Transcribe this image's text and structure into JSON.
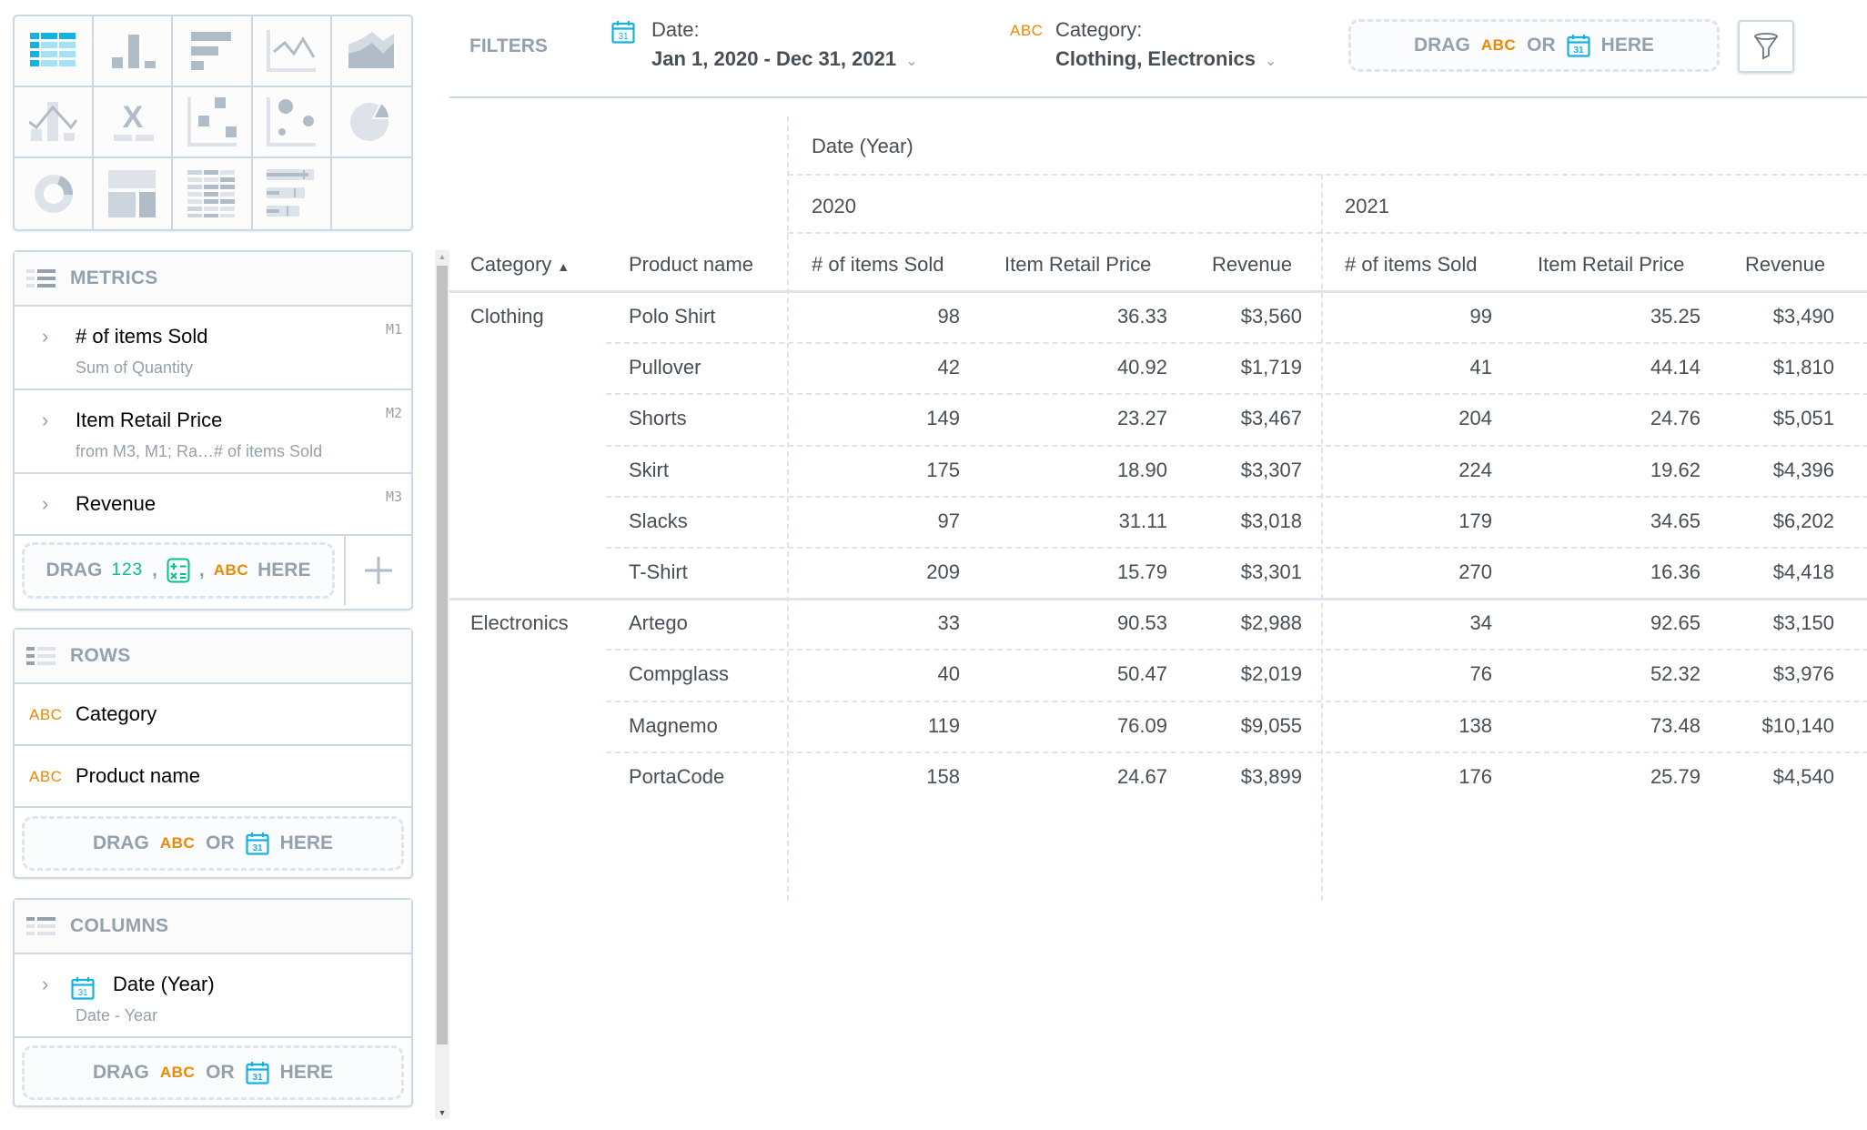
{
  "viz_types": [
    {
      "name": "table",
      "icon": "table-icon",
      "active": true
    },
    {
      "name": "column",
      "icon": "column-chart-icon"
    },
    {
      "name": "bar",
      "icon": "bar-chart-icon"
    },
    {
      "name": "line",
      "icon": "line-chart-icon"
    },
    {
      "name": "area",
      "icon": "area-chart-icon"
    },
    {
      "name": "combo",
      "icon": "combo-chart-icon"
    },
    {
      "name": "headline",
      "icon": "headline-icon"
    },
    {
      "name": "scatter",
      "icon": "scatter-plot-icon"
    },
    {
      "name": "bubble",
      "icon": "bubble-chart-icon"
    },
    {
      "name": "pie",
      "icon": "pie-chart-icon"
    },
    {
      "name": "donut",
      "icon": "donut-chart-icon"
    },
    {
      "name": "treemap",
      "icon": "treemap-icon"
    },
    {
      "name": "heatmap",
      "icon": "heatmap-icon"
    },
    {
      "name": "bullet",
      "icon": "bullet-chart-icon"
    }
  ],
  "metrics": {
    "title": "METRICS",
    "items": [
      {
        "name": "# of items Sold",
        "sub": "Sum of Quantity",
        "id": "M1"
      },
      {
        "name": "Item Retail Price",
        "sub": "from M3, M1; Ra…# of items Sold",
        "id": "M2"
      },
      {
        "name": "Revenue",
        "sub": "",
        "id": "M3"
      }
    ],
    "drop": {
      "drag": "DRAG",
      "num": "123",
      "comma": ",",
      "abc": "ABC",
      "here": "HERE"
    }
  },
  "rows": {
    "title": "ROWS",
    "items": [
      {
        "type": "ABC",
        "name": "Category"
      },
      {
        "type": "ABC",
        "name": "Product name"
      }
    ],
    "drop": {
      "drag": "DRAG",
      "abc": "ABC",
      "or": "OR",
      "here": "HERE"
    }
  },
  "columns": {
    "title": "COLUMNS",
    "items": [
      {
        "name": "Date (Year)",
        "sub": "Date - Year"
      }
    ],
    "drop": {
      "drag": "DRAG",
      "abc": "ABC",
      "or": "OR",
      "here": "HERE"
    }
  },
  "filters": {
    "label": "FILTERS",
    "date": {
      "label": "Date:",
      "value": "Jan 1, 2020 - Dec 31, 2021"
    },
    "category": {
      "type": "ABC",
      "label": "Category:",
      "value": "Clothing, Electronics"
    },
    "drop": {
      "drag": "DRAG",
      "abc": "ABC",
      "or": "OR",
      "here": "HERE"
    }
  },
  "calendar_day": "31",
  "colors": {
    "accent": "#14b2e2",
    "attribute": "#f18600",
    "measure": "#00c18d",
    "muted": "#94a1ad",
    "border": "#ccd8e2"
  },
  "table": {
    "column_attribute": "Date (Year)",
    "row_headers": [
      "Category",
      "Product name"
    ],
    "sort": "Category ascending",
    "years": [
      "2020",
      "2021"
    ],
    "measures": [
      "# of items Sold",
      "Item Retail Price",
      "Revenue"
    ],
    "rows": [
      {
        "category": "Clothing",
        "product": "Polo Shirt",
        "y2020": [
          "98",
          "36.33",
          "$3,560"
        ],
        "y2021": [
          "99",
          "35.25",
          "$3,490"
        ]
      },
      {
        "category": "",
        "product": "Pullover",
        "y2020": [
          "42",
          "40.92",
          "$1,719"
        ],
        "y2021": [
          "41",
          "44.14",
          "$1,810"
        ]
      },
      {
        "category": "",
        "product": "Shorts",
        "y2020": [
          "149",
          "23.27",
          "$3,467"
        ],
        "y2021": [
          "204",
          "24.76",
          "$5,051"
        ]
      },
      {
        "category": "",
        "product": "Skirt",
        "y2020": [
          "175",
          "18.90",
          "$3,307"
        ],
        "y2021": [
          "224",
          "19.62",
          "$4,396"
        ]
      },
      {
        "category": "",
        "product": "Slacks",
        "y2020": [
          "97",
          "31.11",
          "$3,018"
        ],
        "y2021": [
          "179",
          "34.65",
          "$6,202"
        ]
      },
      {
        "category": "",
        "product": "T-Shirt",
        "y2020": [
          "209",
          "15.79",
          "$3,301"
        ],
        "y2021": [
          "270",
          "16.36",
          "$4,418"
        ]
      },
      {
        "category": "Electronics",
        "product": "Artego",
        "y2020": [
          "33",
          "90.53",
          "$2,988"
        ],
        "y2021": [
          "34",
          "92.65",
          "$3,150"
        ]
      },
      {
        "category": "",
        "product": "Compglass",
        "y2020": [
          "40",
          "50.47",
          "$2,019"
        ],
        "y2021": [
          "76",
          "52.32",
          "$3,976"
        ]
      },
      {
        "category": "",
        "product": "Magnemo",
        "y2020": [
          "119",
          "76.09",
          "$9,055"
        ],
        "y2021": [
          "138",
          "73.48",
          "$10,140"
        ]
      },
      {
        "category": "",
        "product": "PortaCode",
        "y2020": [
          "158",
          "24.67",
          "$3,899"
        ],
        "y2021": [
          "176",
          "25.79",
          "$4,540"
        ]
      }
    ]
  }
}
